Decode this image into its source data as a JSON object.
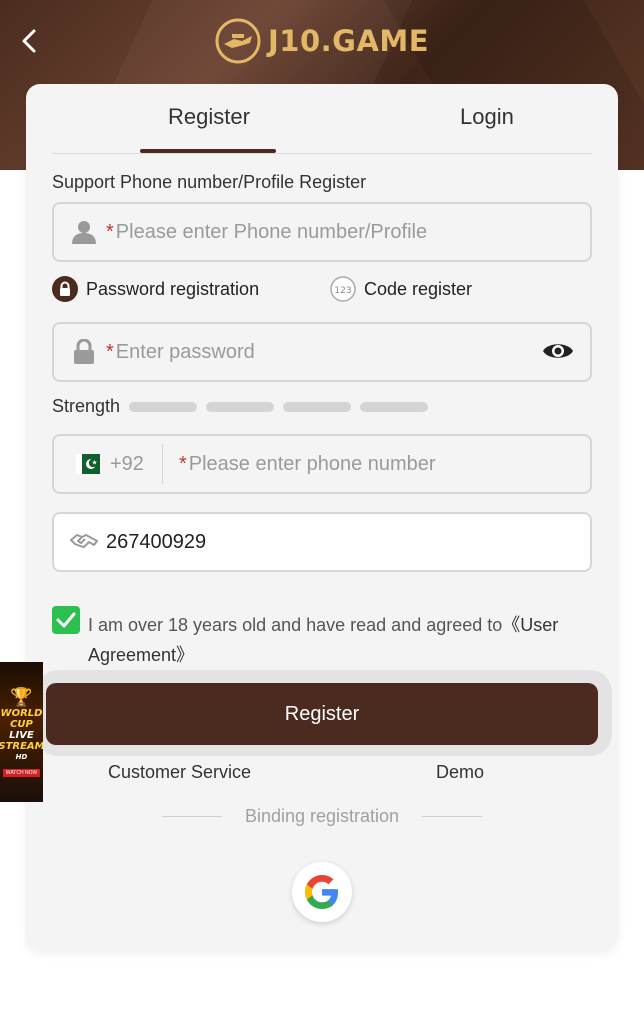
{
  "header": {
    "logo_text": "J10.GAME"
  },
  "tabs": [
    {
      "label": "Register",
      "active": true
    },
    {
      "label": "Login",
      "active": false
    }
  ],
  "form": {
    "account_label": "Support Phone number/Profile Register",
    "account_placeholder": "Please enter Phone number/Profile",
    "required_mark": "*",
    "mode_password_label": "Password registration",
    "mode_code_label": "Code register",
    "mode_code_badge": "123",
    "password_placeholder": "Enter password",
    "strength_label": "Strength",
    "country_code": "+92",
    "phone_placeholder": "Please enter phone number",
    "invite_code_value": "267400929",
    "agree_text": "I am over 18 years old and have read and agreed to",
    "agree_link": "《User Agreement》",
    "agree_checked": true,
    "register_button": "Register"
  },
  "footer_links": {
    "customer_service": "Customer Service",
    "demo": "Demo",
    "binding_label": "Binding registration"
  },
  "promo": {
    "line1": "WORLD",
    "line2": "CUP",
    "line3": "LIVE",
    "line4": "STREAM",
    "badge": "HD",
    "cta": "WATCH NOW"
  },
  "colors": {
    "brand_brown": "#4b2a1f",
    "accent_gold": "#e2b766",
    "check_green": "#2dbf4f",
    "required_red": "#c0392b"
  }
}
